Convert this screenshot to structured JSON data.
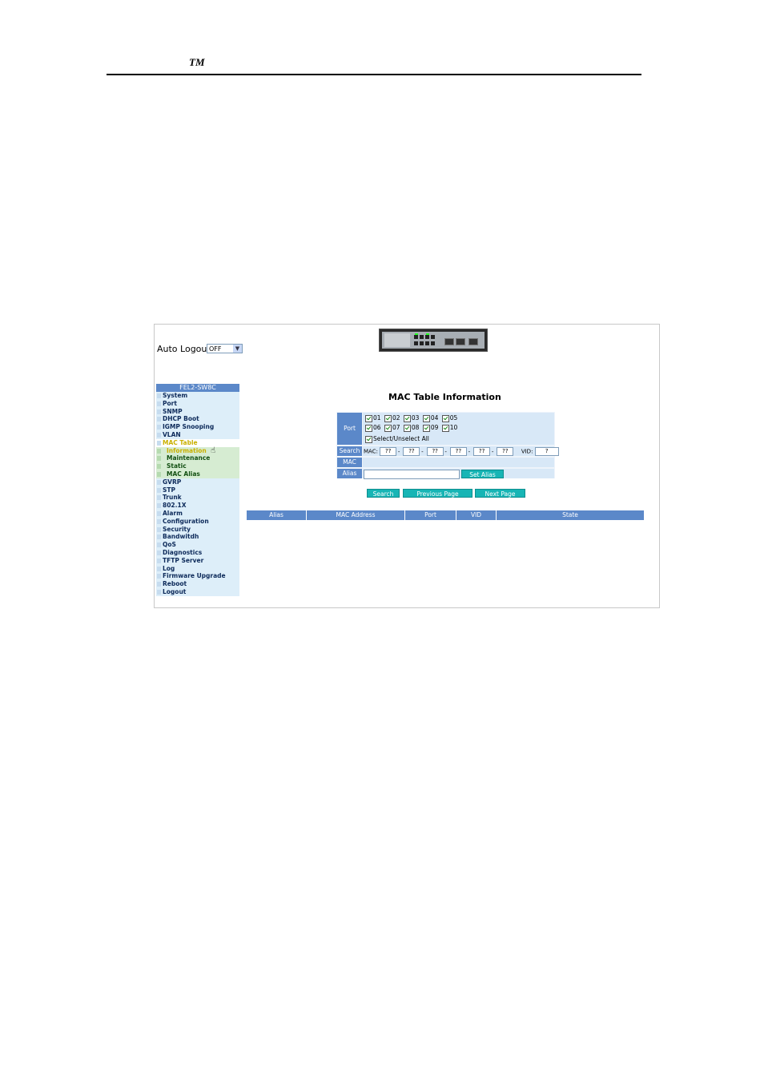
{
  "doc": {
    "tm": "TM"
  },
  "header": {
    "auto_logout_label": "Auto Logout",
    "auto_logout_value": "OFF"
  },
  "sidebar": {
    "title": "FEL2-SW8C",
    "items": [
      {
        "label": "System"
      },
      {
        "label": "Port"
      },
      {
        "label": "SNMP"
      },
      {
        "label": "DHCP Boot"
      },
      {
        "label": "IGMP Snooping"
      },
      {
        "label": "VLAN"
      },
      {
        "label": "MAC Table"
      },
      {
        "label": "Information"
      },
      {
        "label": "Maintenance"
      },
      {
        "label": "Static"
      },
      {
        "label": "MAC Alias"
      },
      {
        "label": "GVRP"
      },
      {
        "label": "STP"
      },
      {
        "label": "Trunk"
      },
      {
        "label": "802.1X"
      },
      {
        "label": "Alarm"
      },
      {
        "label": "Configuration"
      },
      {
        "label": "Security"
      },
      {
        "label": "Bandwitdh"
      },
      {
        "label": "QoS"
      },
      {
        "label": "Diagnostics"
      },
      {
        "label": "TFTP Server"
      },
      {
        "label": "Log"
      },
      {
        "label": "Firmware Upgrade"
      },
      {
        "label": "Reboot"
      },
      {
        "label": "Logout"
      }
    ]
  },
  "main": {
    "title": "MAC Table Information",
    "form": {
      "port_label": "Port",
      "ports_row1": [
        "01",
        "02",
        "03",
        "04",
        "05"
      ],
      "ports_row2": [
        "06",
        "07",
        "08",
        "09",
        "10"
      ],
      "select_all_label": "Select/Unselect All",
      "search_label": "Search",
      "mac_prefix": "MAC:",
      "mac_octets": [
        "??",
        "??",
        "??",
        "??",
        "??",
        "??"
      ],
      "mac_sep": "-",
      "vid_label": "VID:",
      "vid_value": "?",
      "mac_label": "MAC",
      "alias_label": "Alias",
      "set_alias_button": "Set Alias"
    },
    "buttons": {
      "search": "Search",
      "previous": "Previous Page",
      "next": "Next Page"
    },
    "table": {
      "columns": [
        "Alias",
        "MAC Address",
        "Port",
        "VID",
        "State"
      ]
    }
  },
  "colors": {
    "menu_blue": "#5b88c9",
    "menu_bg": "#ddeef9",
    "submenu_bg": "#d6ecd2",
    "active_yellow": "#c9b000",
    "button_teal": "#17b5b5"
  }
}
